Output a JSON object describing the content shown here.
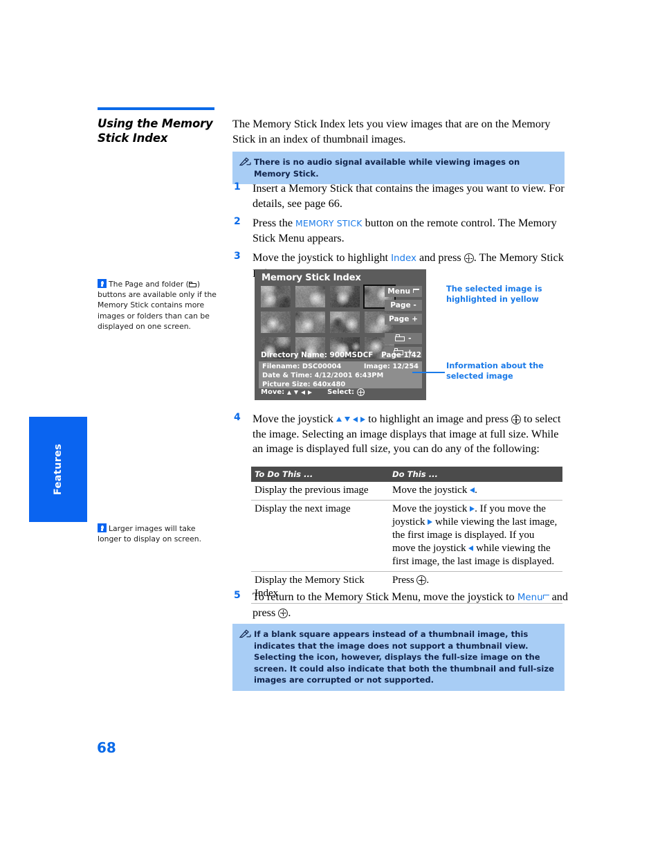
{
  "section": {
    "title": "Using the Memory Stick Index"
  },
  "intro": "The Memory Stick Index lets you view images that are on the Memory Stick in an index of thumbnail images.",
  "notes": [
    {
      "icon": "note-pen-icon",
      "text": "There is no audio signal available while viewing images on Memory Stick."
    },
    {
      "icon": "note-pen-icon",
      "text": "If a blank square appears instead of a thumbnail image, this indicates that the image does not support a thumbnail view. Selecting the icon, however, displays the full-size image on the screen. It could also indicate that both the thumbnail and full-size images are corrupted or not supported."
    }
  ],
  "steps": [
    {
      "num": "1",
      "parts": [
        {
          "t": "text",
          "v": "Insert a Memory Stick that contains the images you want to view. For details, see page 66."
        }
      ]
    },
    {
      "num": "2",
      "parts": [
        {
          "t": "text",
          "v": "Press the "
        },
        {
          "t": "kwsm",
          "v": "MEMORY STICK"
        },
        {
          "t": "text",
          "v": " button on the remote control. The Memory Stick Menu appears."
        }
      ]
    },
    {
      "num": "3",
      "parts": [
        {
          "t": "text",
          "v": "Move the joystick to highlight "
        },
        {
          "t": "kw",
          "v": "Index"
        },
        {
          "t": "text",
          "v": " and press "
        },
        {
          "t": "jbtn",
          "v": "select-button-icon"
        },
        {
          "t": "text",
          "v": ". The Memory Stick Index appears."
        }
      ]
    },
    {
      "num": "4",
      "parts": [
        {
          "t": "text",
          "v": "Move the joystick "
        },
        {
          "t": "arrows",
          "v": "up down left right"
        },
        {
          "t": "text",
          "v": " to highlight an image and press "
        },
        {
          "t": "jbtn",
          "v": "select-button-icon"
        },
        {
          "t": "text",
          "v": " to select the image. Selecting an image displays that image at full size. While an image is displayed full size, you can do any of the following:"
        }
      ]
    },
    {
      "num": "5",
      "parts": [
        {
          "t": "text",
          "v": "To return to the Memory Stick Menu, move the joystick to "
        },
        {
          "t": "kw",
          "v": "Menu"
        },
        {
          "t": "retglyph",
          "v": "return-arrow-icon"
        },
        {
          "t": "text",
          "v": " and press "
        },
        {
          "t": "jbtn",
          "v": "select-button-icon"
        },
        {
          "t": "text",
          "v": "."
        }
      ]
    }
  ],
  "tips": [
    {
      "icon": "lightbulb-icon",
      "pre": "The Page and folder (",
      "glyph": "folder-icon",
      "post": ") buttons are available only if the Memory Stick contains more images or folders than can be displayed on one screen."
    },
    {
      "icon": "lightbulb-icon",
      "pre": "Larger images will take longer to display on screen.",
      "glyph": "",
      "post": ""
    }
  ],
  "tv_screen": {
    "title": "Memory Stick Index",
    "selected_index": 3,
    "buttons": [
      {
        "label": "Menu",
        "icon": "return-arrow-icon"
      },
      {
        "label": "Page -",
        "icon": ""
      },
      {
        "label": "Page +",
        "icon": ""
      }
    ],
    "folder_buttons": [
      {
        "label": "-",
        "icon": "folder-icon"
      },
      {
        "label": "+",
        "icon": "folder-icon"
      }
    ],
    "directory_name": "Directory Name: 900MSDCF",
    "page_indicator": "Page 1/42",
    "info": {
      "filename": "Filename: DSC00004",
      "image_count": "Image: 12/254",
      "datetime": "Date & Time: 4/12/2001 6:43PM",
      "picture_size": "Picture Size: 640x480"
    },
    "move_label": "Move:",
    "select_label": "Select:"
  },
  "callouts": [
    {
      "text": "The selected image is highlighted in yellow"
    },
    {
      "text": "Information about the selected image"
    }
  ],
  "table": {
    "headers": [
      "To Do This ...",
      "Do This ..."
    ],
    "rows": [
      {
        "c1": "Display the previous image",
        "c2_parts": [
          {
            "t": "text",
            "v": "Move the joystick "
          },
          {
            "t": "arr-l",
            "v": "left-arrow-icon"
          },
          {
            "t": "text",
            "v": "."
          }
        ]
      },
      {
        "c1": "Display the next image",
        "c2_parts": [
          {
            "t": "text",
            "v": "Move the joystick "
          },
          {
            "t": "arr-r",
            "v": "right-arrow-icon"
          },
          {
            "t": "text",
            "v": ". If you move the joystick "
          },
          {
            "t": "arr-r",
            "v": "right-arrow-icon"
          },
          {
            "t": "text",
            "v": " while viewing the last image, the first image is displayed. If you move the joystick "
          },
          {
            "t": "arr-l",
            "v": "left-arrow-icon"
          },
          {
            "t": "text",
            "v": " while viewing the first image, the last image is displayed."
          }
        ]
      },
      {
        "c1": "Display the Memory Stick Index",
        "c2_parts": [
          {
            "t": "text",
            "v": "Press "
          },
          {
            "t": "jbtn",
            "v": "select-button-icon"
          },
          {
            "t": "text",
            "v": "."
          }
        ]
      }
    ]
  },
  "sidebar_tab": {
    "label": "Features"
  },
  "page_number": "68",
  "colors": {
    "accent_blue": "#0a6ae8",
    "link_blue": "#1a7ae8",
    "note_bg": "#a8cdf5",
    "tab_blue": "#0a64f0",
    "table_header": "#4b4b4b",
    "tv_bg": "#5c5c5c",
    "tv_button": "#787878",
    "tv_info_panel": "#8e8e8e"
  }
}
